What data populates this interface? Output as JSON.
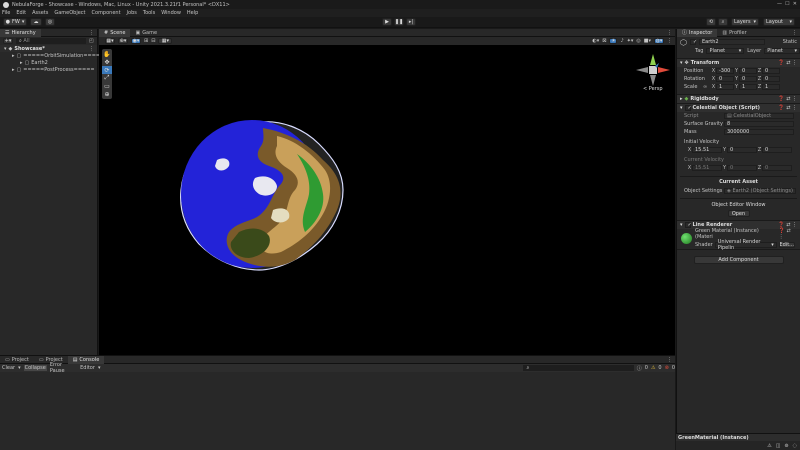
{
  "window": {
    "title": "NebulaForge - Showcase - Windows, Mac, Linux - Unity 2021.3.21f1 Personal* <DX11>"
  },
  "menu": [
    "File",
    "Edit",
    "Assets",
    "GameObject",
    "Component",
    "Jobs",
    "Tools",
    "Window",
    "Help"
  ],
  "toolbar": {
    "account": "FW",
    "layers": "Layers",
    "layout": "Layout"
  },
  "hierarchy": {
    "tab": "Hierarchy",
    "search_placeholder": "All",
    "items": [
      {
        "label": "Showcase*",
        "indent": 0
      },
      {
        "label": "=====OrbitSimulation=====",
        "indent": 1
      },
      {
        "label": "Earth2",
        "indent": 2
      },
      {
        "label": "=====PostProcess=====",
        "indent": 1
      }
    ]
  },
  "scene": {
    "tabs": [
      "Scene",
      "Game"
    ],
    "gizmo_view": "< Persp"
  },
  "bottom": {
    "tabs": [
      "Project",
      "Project",
      "Console"
    ],
    "console_buttons": [
      "Clear",
      "Collapse",
      "Error Pause",
      "Editor"
    ],
    "counts": [
      "0",
      "0",
      "0"
    ]
  },
  "inspector": {
    "tabs": [
      "Inspector",
      "Profiler"
    ],
    "object_name": "Earth2",
    "static_label": "Static",
    "tag_label": "Tag",
    "tag_value": "Planet",
    "layer_label": "Layer",
    "layer_value": "Planet",
    "transform": {
      "title": "Transform",
      "position": {
        "label": "Position",
        "x": "-300",
        "y": "0",
        "z": "0"
      },
      "rotation": {
        "label": "Rotation",
        "x": "0",
        "y": "0",
        "z": "0"
      },
      "scale": {
        "label": "Scale",
        "x": "1",
        "y": "1",
        "z": "1"
      }
    },
    "rigidbody": {
      "title": "Rigidbody"
    },
    "celestial": {
      "title": "Celestial Object (Script)",
      "script_label": "Script",
      "script_value": "CelestialObject",
      "surface_gravity_label": "Surface Gravity",
      "surface_gravity": "8",
      "mass_label": "Mass",
      "mass": "3000000",
      "initial_velocity_label": "Initial Velocity",
      "initial_velocity": {
        "x": "15.51",
        "y": "0",
        "z": "0"
      },
      "current_velocity_label": "Current Velocity",
      "current_velocity": {
        "x": "15.51",
        "y": "0",
        "z": "0"
      },
      "current_asset_label": "Current Asset",
      "object_settings_label": "Object Settings",
      "object_settings_value": "Earth2 (Object Settings)",
      "editor_window_label": "Object Editor Window",
      "open_button": "Open"
    },
    "line_renderer": {
      "title": "Line Renderer"
    },
    "material": {
      "name": "Green Material (Instance) (Materi",
      "shader_label": "Shader",
      "shader_value": "Universal Render Pipelin",
      "edit_button": "Edit..."
    },
    "add_component": "Add Component",
    "status_label": "GreenMaterial (Instance)"
  },
  "colors": {
    "accent": "#3a79bb",
    "panel": "#282828",
    "ocean": "#2323d8"
  }
}
